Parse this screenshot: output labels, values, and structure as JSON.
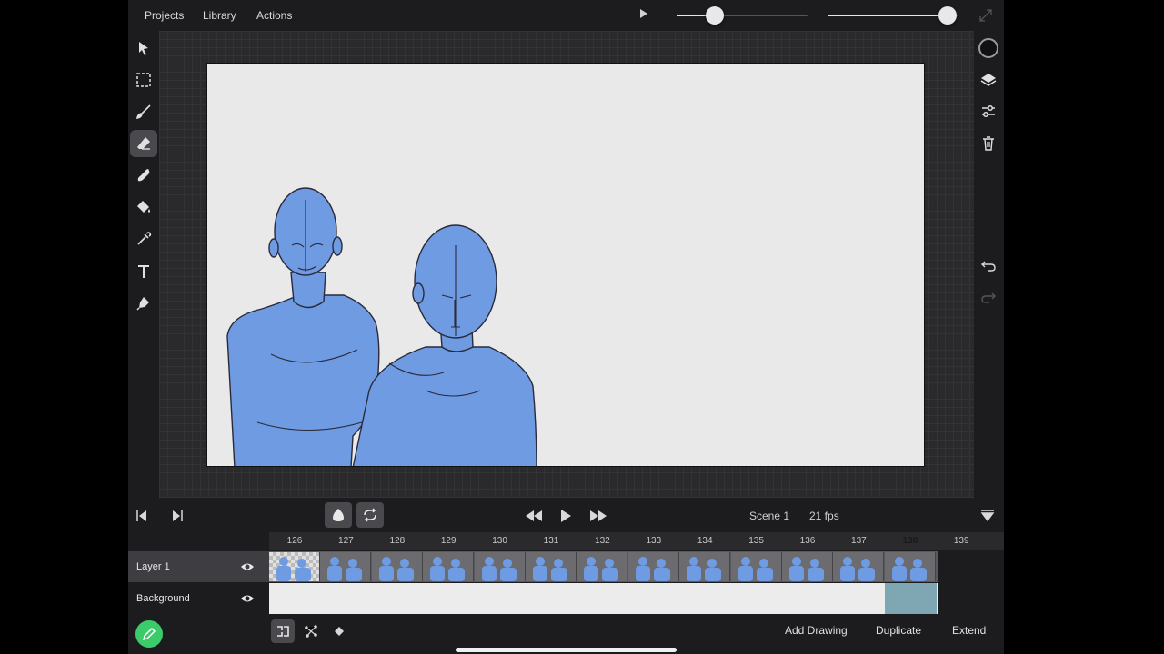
{
  "menu": {
    "projects": "Projects",
    "library": "Library",
    "actions": "Actions"
  },
  "sliders": {
    "brush_size": 0.29,
    "opacity": 0.92
  },
  "colors": {
    "accent": "#3ccb6a",
    "current_frame": "#7fb8c9",
    "figure_fill": "#6f9be3",
    "brush_color": "#111111"
  },
  "tools": [
    "selection-arrow-icon",
    "marquee-select-icon",
    "brush-icon",
    "eraser-icon",
    "smudge-icon",
    "fill-bucket-icon",
    "eyedropper-icon",
    "text-icon",
    "pen-icon"
  ],
  "active_tool": "eraser-icon",
  "transport": {
    "scene": "Scene 1",
    "fps": "21 fps"
  },
  "timeline": {
    "frames": [
      "126",
      "127",
      "128",
      "129",
      "130",
      "131",
      "132",
      "133",
      "134",
      "135",
      "136",
      "137",
      "138",
      "139"
    ],
    "current_frame": "138",
    "layers": [
      {
        "name": "Layer 1",
        "visible": true
      },
      {
        "name": "Background",
        "visible": true
      }
    ]
  },
  "bottom": {
    "add_drawing": "Add Drawing",
    "duplicate": "Duplicate",
    "extend": "Extend"
  }
}
